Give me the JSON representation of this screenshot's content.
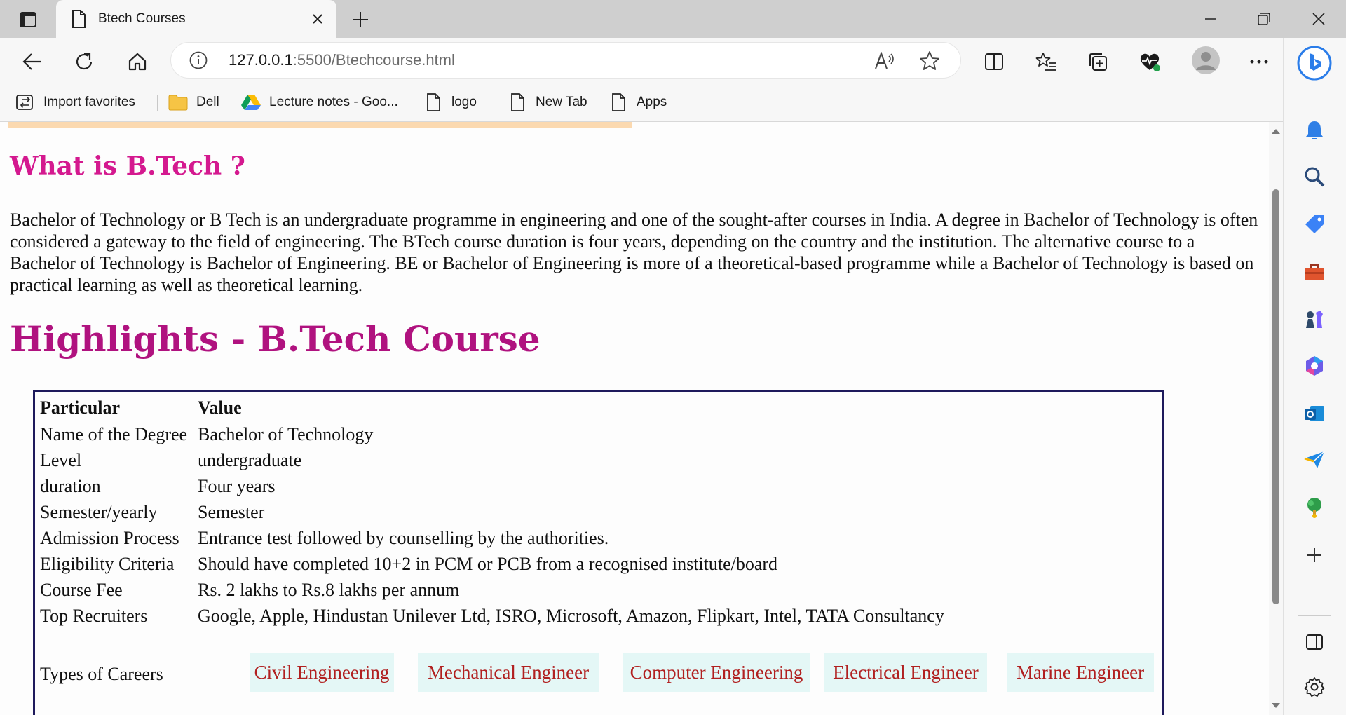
{
  "browser": {
    "tab_title": "Btech Courses",
    "url_host": "127.0.0.1",
    "url_path": ":5500/Btechcourse.html",
    "favorites": [
      {
        "label": "Import favorites",
        "icon": "import-icon"
      },
      {
        "label": "Dell",
        "icon": "folder-icon"
      },
      {
        "label": "Lecture notes - Goo...",
        "icon": "google-drive-icon"
      },
      {
        "label": "logo",
        "icon": "page-icon"
      },
      {
        "label": "New Tab",
        "icon": "page-icon"
      },
      {
        "label": "Apps",
        "icon": "page-icon"
      }
    ]
  },
  "page": {
    "what_heading": "What is B.Tech ?",
    "intro": "Bachelor of Technology or B Tech is an undergraduate programme in engineering and one of the sought-after courses in India. A degree in Bachelor of Technology is often considered a gateway to the field of engineering. The BTech course duration is four years, depending on the country and the institution. The alternative course to a Bachelor of Technology is Bachelor of Engineering. BE or Bachelor of Engineering is more of a theoretical-based programme while a Bachelor of Technology is based on practical learning as well as theoretical learning.",
    "highlights_heading": "Highlights - B.Tech Course",
    "table": {
      "headers": [
        "Particular",
        "Value"
      ],
      "rows": [
        [
          "Name of the Degree",
          "Bachelor of Technology"
        ],
        [
          "Level",
          "undergraduate"
        ],
        [
          "duration",
          "Four years"
        ],
        [
          "Semester/yearly",
          "Semester"
        ],
        [
          "Admission Process",
          "Entrance test followed by counselling by the authorities."
        ],
        [
          "Eligibility Criteria",
          "Should have completed 10+2 in PCM or PCB from a recognised institute/board"
        ],
        [
          "Course Fee",
          "Rs. 2 lakhs to Rs.8 lakhs per annum"
        ],
        [
          "Top Recruiters",
          "Google, Apple, Hindustan Unilever Ltd, ISRO, Microsoft, Amazon, Flipkart, Intel, TATA Consultancy"
        ]
      ],
      "careers_label": "Types of Careers",
      "careers": [
        "Civil Engineering",
        "Mechanical Engineer",
        "Computer Engineering",
        "Electrical Engineer",
        "Marine Engineer"
      ]
    }
  },
  "colors": {
    "heading_small": "#d4198f",
    "heading_large": "#b0127f",
    "career_text": "#b12020",
    "career_bg": "#e4f7f6",
    "table_border": "#1e1a5c"
  }
}
